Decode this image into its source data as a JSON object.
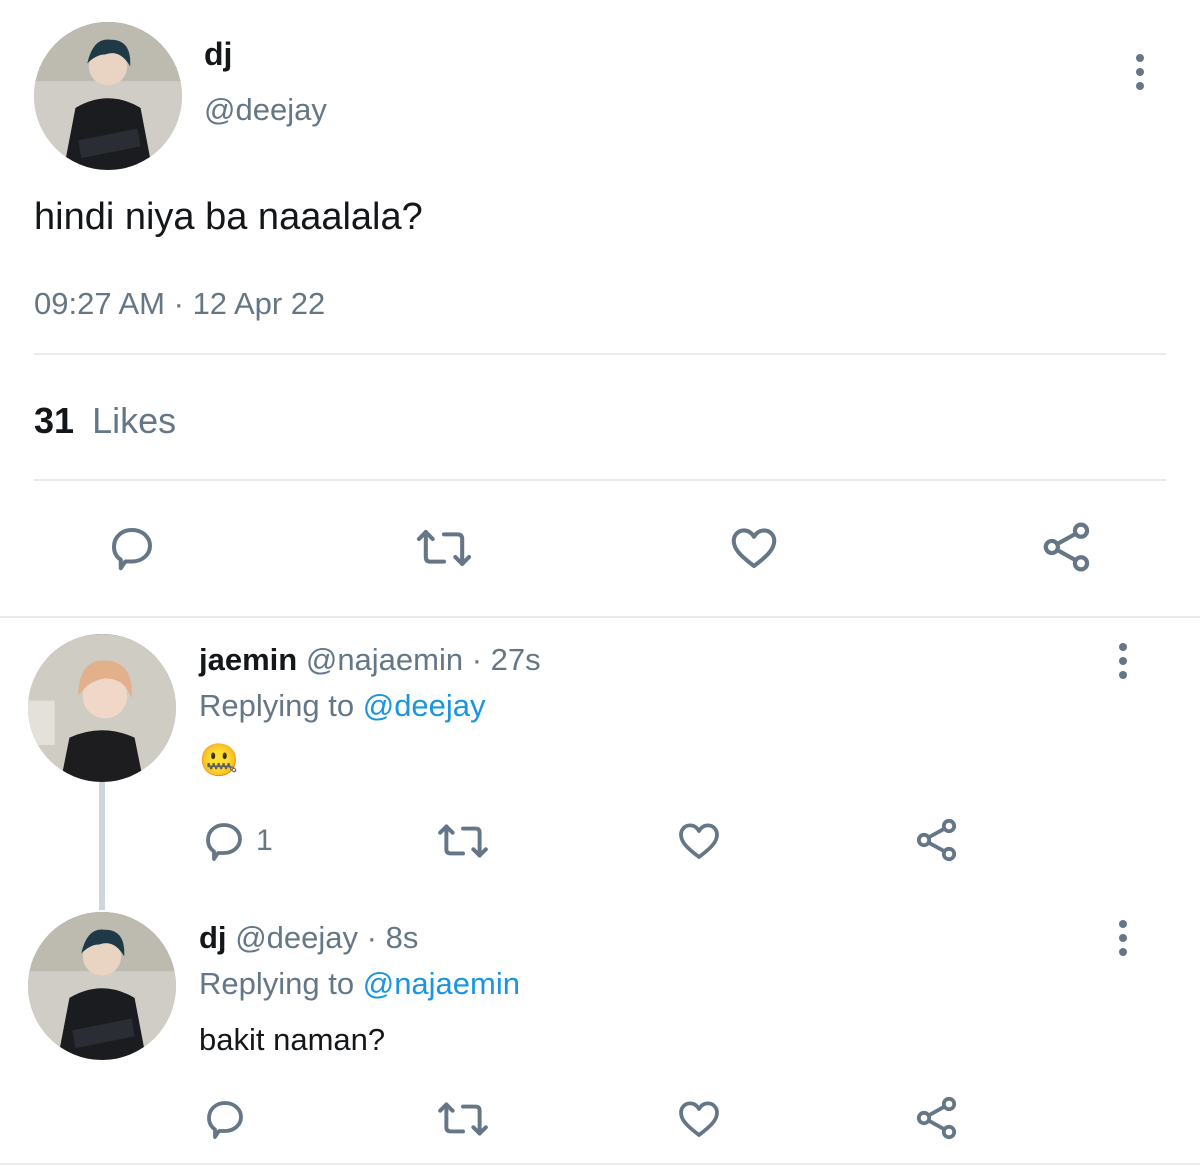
{
  "main_tweet": {
    "display_name": "dj",
    "handle": "@deejay",
    "text": "hindi niya ba naaalala?",
    "time": "09:27 AM",
    "separator": "·",
    "date": "12 Apr 22",
    "likes_count": "31",
    "likes_label": "Likes"
  },
  "replies": [
    {
      "display_name": "jaemin",
      "handle": "@najaemin",
      "age": "· 27s",
      "replying_label": "Replying to",
      "replying_handle": "@deejay",
      "text": "🤐",
      "reply_count": "1"
    },
    {
      "display_name": "dj",
      "handle": "@deejay",
      "age": "· 8s",
      "replying_label": "Replying to",
      "replying_handle": "@najaemin",
      "text": "bakit naman?"
    }
  ],
  "colors": {
    "muted": "#657786",
    "link": "#1b95e0",
    "divider": "#e6ecf0",
    "text": "#14171a"
  },
  "icons": [
    "reply-icon",
    "retweet-icon",
    "like-icon",
    "share-icon",
    "more-icon"
  ]
}
